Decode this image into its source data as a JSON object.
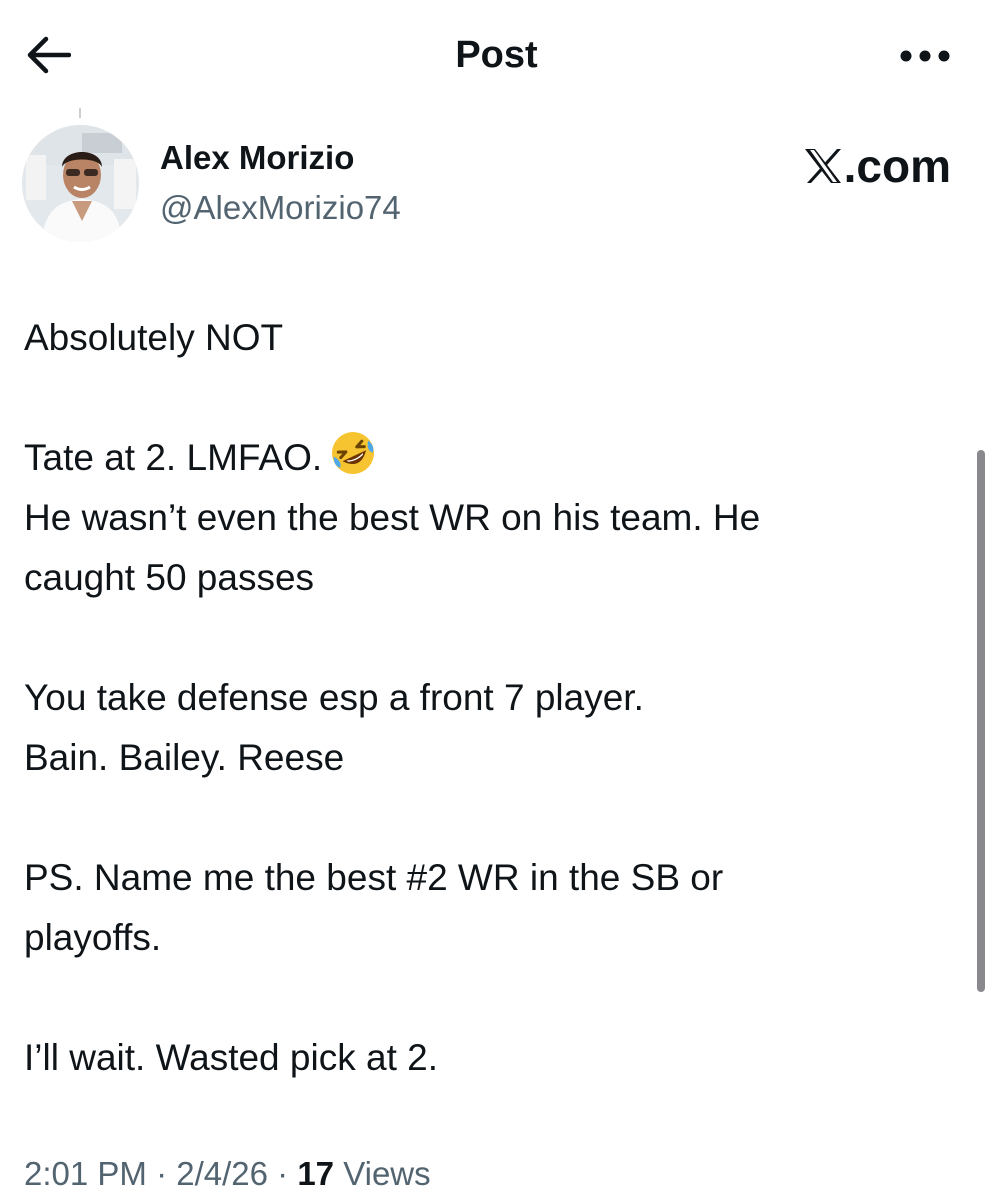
{
  "header": {
    "title": "Post",
    "back_icon": "arrow-left-icon",
    "more_icon": "more-horizontal-icon"
  },
  "author": {
    "name": "Alex Morizio",
    "handle": "@AlexMorizio74",
    "avatar": "profile-photo"
  },
  "brand": {
    "label": ".com",
    "logo_icon": "x-logo-icon"
  },
  "tweet": {
    "lines": [
      "Absolutely NOT",
      "",
      "Tate at 2. LMFAO.",
      "He wasn’t even the best WR on his team. He",
      "caught 50 passes",
      "",
      "You take defense esp a front 7 player.",
      "Bain. Bailey. Reese",
      "",
      "PS. Name me the best #2 WR in the SB or",
      "playoffs.",
      "",
      "I’ll wait.  Wasted pick at 2."
    ],
    "emoji": "rolling-on-floor-laughing-emoji"
  },
  "meta": {
    "time": "2:01 PM",
    "separator": " · ",
    "date": "2/4/26",
    "views_count": "17",
    "views_label": " Views"
  },
  "colors": {
    "text": "#0f1419",
    "secondary_text": "#536471",
    "background": "#ffffff",
    "scrollbar": "#8a8a8e"
  }
}
